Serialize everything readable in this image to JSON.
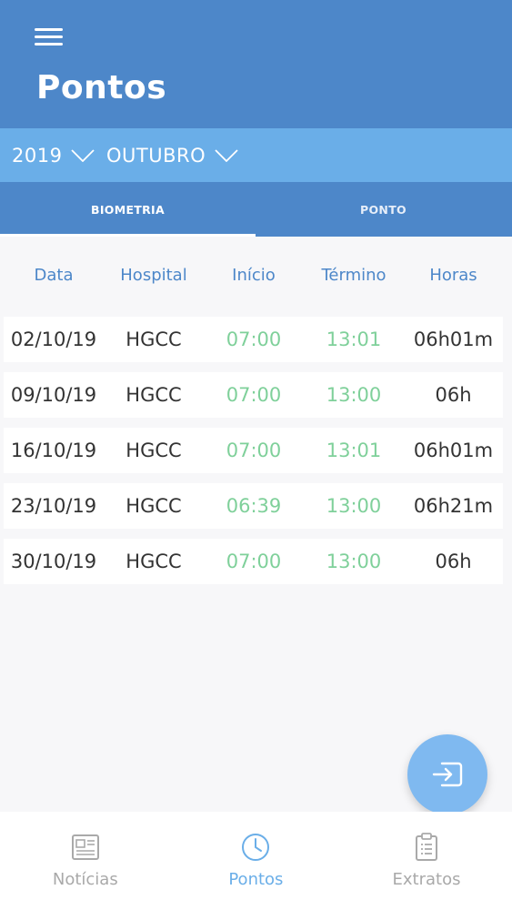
{
  "header": {
    "title": "Pontos"
  },
  "filters": {
    "year": "2019",
    "month": "OUTUBRO"
  },
  "tabs": [
    {
      "label": "BIOMETRIA",
      "active": true
    },
    {
      "label": "PONTO",
      "active": false
    }
  ],
  "table": {
    "columns": [
      "Data",
      "Hospital",
      "Início",
      "Término",
      "Horas"
    ],
    "rows": [
      [
        "02/10/19",
        "HGCC",
        "07:00",
        "13:01",
        "06h01m"
      ],
      [
        "09/10/19",
        "HGCC",
        "07:00",
        "13:00",
        "06h"
      ],
      [
        "16/10/19",
        "HGCC",
        "07:00",
        "13:01",
        "06h01m"
      ],
      [
        "23/10/19",
        "HGCC",
        "06:39",
        "13:00",
        "06h21m"
      ],
      [
        "30/10/19",
        "HGCC",
        "07:00",
        "13:00",
        "06h"
      ]
    ]
  },
  "bottom_nav": [
    {
      "label": "Notícias",
      "icon": "newspaper-icon"
    },
    {
      "label": "Pontos",
      "icon": "clock-icon",
      "active": true
    },
    {
      "label": "Extratos",
      "icon": "clipboard-icon"
    }
  ],
  "colors": {
    "header": "#4d87c9",
    "filter_bar": "#6aaee8",
    "time_green": "#7fd09a",
    "fab": "#7fb9f0"
  },
  "fab": {
    "icon": "exit-icon"
  }
}
